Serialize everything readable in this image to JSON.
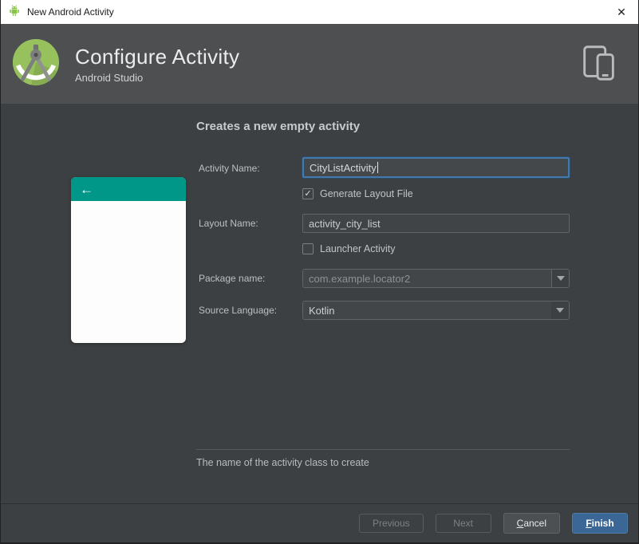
{
  "colors": {
    "accent_blue": "#3a6795",
    "focus_border": "#4379ad",
    "teal": "#009688",
    "android_green": "#8bc34a",
    "header_gray": "#4d4f50",
    "content_gray": "#3d4042"
  },
  "titlebar": {
    "title": "New Android Activity",
    "close_glyph": "✕"
  },
  "header": {
    "title": "Configure Activity",
    "subtitle": "Android Studio"
  },
  "preview": {
    "back_glyph": "←"
  },
  "form": {
    "heading": "Creates a new empty activity",
    "activity_name": {
      "label": "Activity Name:",
      "value": "CityListActivity"
    },
    "generate_layout_file": {
      "label": "Generate Layout File",
      "checked": true,
      "check_glyph": "✓"
    },
    "layout_name": {
      "label": "Layout Name:",
      "value": "activity_city_list"
    },
    "launcher_activity": {
      "label": "Launcher Activity",
      "checked": false
    },
    "package_name": {
      "label": "Package name:",
      "value": "com.example.locator2"
    },
    "source_language": {
      "label": "Source Language:",
      "value": "Kotlin"
    },
    "status_text": "The name of the activity class to create"
  },
  "footer": {
    "previous_label": "Previous",
    "next_label": "Next",
    "cancel_initial": "C",
    "cancel_rest": "ancel",
    "finish_initial": "F",
    "finish_rest": "inish"
  }
}
